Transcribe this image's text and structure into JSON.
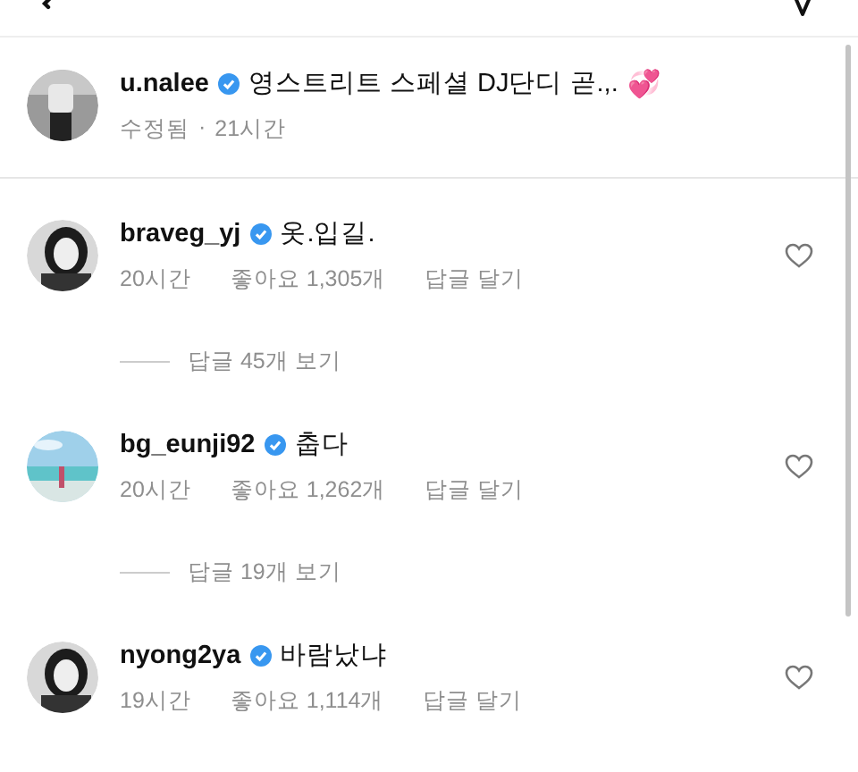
{
  "post": {
    "username": "u.nalee",
    "verified": true,
    "text": "영스트리트 스페셜 DJ단디 곧.,.",
    "emoji": "💞",
    "edited": "수정됨",
    "separator": "·",
    "time": "21시간"
  },
  "comments": [
    {
      "username": "braveg_yj",
      "verified": true,
      "text": "옷.입길.",
      "time": "20시간",
      "likes": "좋아요 1,305개",
      "reply": "답글 달기",
      "view_replies": "답글 45개 보기"
    },
    {
      "username": "bg_eunji92",
      "verified": true,
      "text": "춥다",
      "time": "20시간",
      "likes": "좋아요 1,262개",
      "reply": "답글 달기",
      "view_replies": "답글 19개 보기"
    },
    {
      "username": "nyong2ya",
      "verified": true,
      "text": "바람났냐",
      "time": "19시간",
      "likes": "좋아요 1,114개",
      "reply": "답글 달기"
    }
  ]
}
